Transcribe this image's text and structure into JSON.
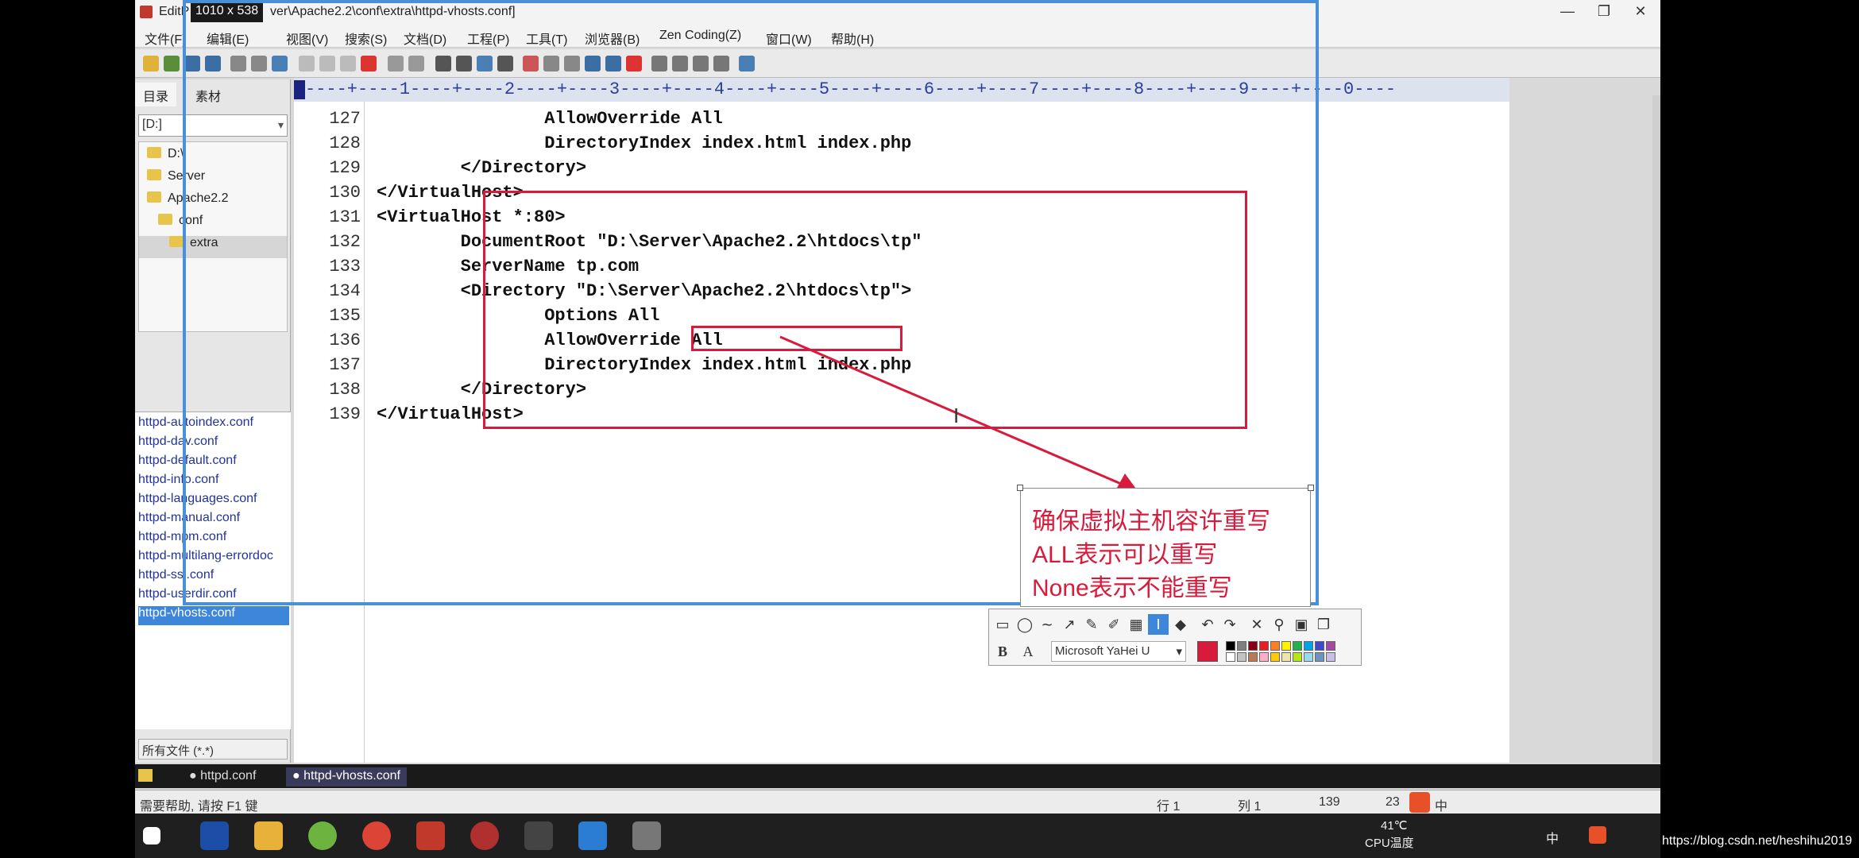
{
  "window": {
    "title_prefix": "EditP",
    "size_badge": "1010 x 538",
    "title": "ver\\Apache2.2\\conf\\extra\\httpd-vhosts.conf]",
    "buttons": [
      "—",
      "❐",
      "✕"
    ]
  },
  "menu": [
    "文件(F)",
    "编辑(E)",
    "视图(V)",
    "搜索(S)",
    "文档(D)",
    "工程(P)",
    "工具(T)",
    "浏览器(B)",
    "Zen Coding(Z)",
    "窗口(W)",
    "帮助(H)"
  ],
  "panel": {
    "tabs": [
      "目录",
      "素材"
    ],
    "drive": "[D:]",
    "tree": [
      "D:\\",
      "Server",
      "Apache2.2",
      "conf",
      "extra"
    ],
    "files": [
      "httpd-autoindex.conf",
      "httpd-dav.conf",
      "httpd-default.conf",
      "httpd-info.conf",
      "httpd-languages.conf",
      "httpd-manual.conf",
      "httpd-mpm.conf",
      "httpd-multilang-errordoc",
      "httpd-ssl.conf",
      "httpd-userdir.conf",
      "httpd-vhosts.conf"
    ],
    "selected_file": "httpd-vhosts.conf",
    "filter": "所有文件 (*.*)"
  },
  "editor": {
    "ruler": "----+----1----+----2----+----3----+----4----+----5----+----6----+----7----+----8----+----9----+----0----",
    "lines": [
      {
        "num": "127",
        "text": "                AllowOverride All"
      },
      {
        "num": "128",
        "text": "                DirectoryIndex index.html index.php"
      },
      {
        "num": "129",
        "text": "        </Directory>"
      },
      {
        "num": "130",
        "text": "</VirtualHost>"
      },
      {
        "num": "131",
        "text": "<VirtualHost *:80>"
      },
      {
        "num": "132",
        "text": "        DocumentRoot \"D:\\Server\\Apache2.2\\htdocs\\tp\""
      },
      {
        "num": "133",
        "text": "        ServerName tp.com"
      },
      {
        "num": "134",
        "text": "        <Directory \"D:\\Server\\Apache2.2\\htdocs\\tp\">"
      },
      {
        "num": "135",
        "text": "                Options All"
      },
      {
        "num": "136",
        "text": "                AllowOverride All"
      },
      {
        "num": "137",
        "text": "                DirectoryIndex index.html index.php"
      },
      {
        "num": "138",
        "text": "        </Directory>"
      },
      {
        "num": "139",
        "text": "</VirtualHost>"
      }
    ]
  },
  "annotation": {
    "note": [
      "确保虚拟主机容许重写",
      "ALL表示可以重写",
      "None表示不能重写"
    ],
    "font": "Microsoft YaHei U",
    "bold_label": "B",
    "style_label": "A",
    "accent": "#d81b3c",
    "palette": [
      "#000000",
      "#7f7f7f",
      "#880015",
      "#ed1c24",
      "#ff7f27",
      "#fff200",
      "#22b14c",
      "#00a2e8",
      "#3f48cc",
      "#a349a4",
      "#ffffff",
      "#c3c3c3",
      "#b97a57",
      "#ffaec9",
      "#ffc90e",
      "#efe4b0",
      "#b5e61d",
      "#99d9ea",
      "#7092be",
      "#c8bfe7"
    ]
  },
  "tabs": {
    "open": [
      "httpd.conf",
      "httpd-vhosts.conf"
    ]
  },
  "status": {
    "help": "需要帮助, 请按 F1 键",
    "line": "行 1",
    "col": "列 1",
    "total": "139",
    "chars": "23"
  },
  "taskbar": {
    "temp": "41℃",
    "temp_label": "CPU温度",
    "ime": "中"
  },
  "watermark": "https://blog.csdn.net/heshihu2019"
}
